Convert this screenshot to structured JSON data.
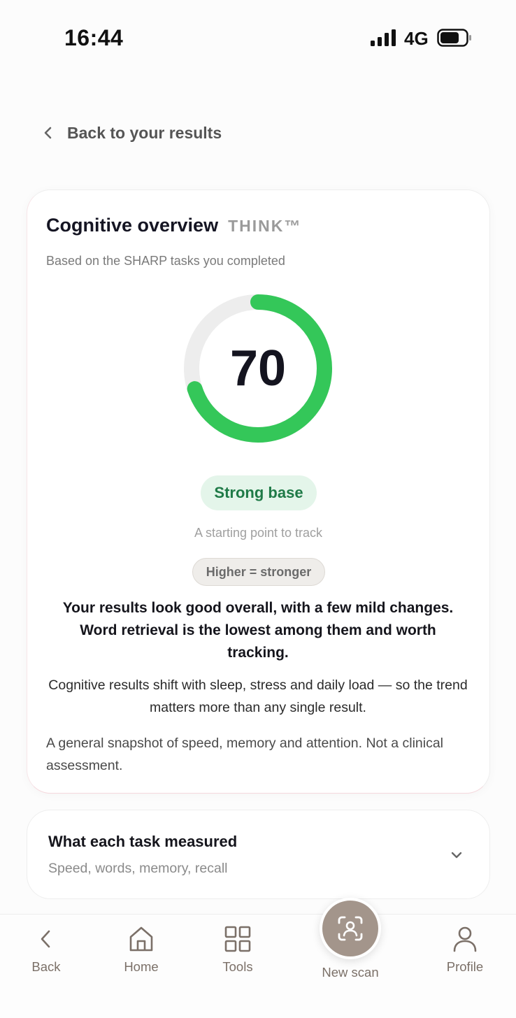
{
  "status_bar": {
    "time": "16:44",
    "network": "4G"
  },
  "back_link": {
    "label": "Back to your results"
  },
  "overview": {
    "title": "Cognitive overview",
    "brand": "THINK™",
    "subtitle": "Based on the SHARP tasks you completed",
    "score": "70",
    "score_fraction": 0.7,
    "ring_color": "#34c759",
    "ring_track_color": "#ededed",
    "status_label": "Strong base",
    "status_caption": "A starting point to track",
    "scale_hint": "Higher = stronger",
    "summary": "Your results look good overall, with a few mild changes. Word retrieval is the lowest among them and worth tracking.",
    "trend_note": "Cognitive results shift with sleep, stress and daily load — so the trend matters more than any single result.",
    "disclaimer": "A general snapshot of speed, memory and attention. Not a clinical assessment."
  },
  "task_section": {
    "title": "What each task measured",
    "subtitle": "Speed, words, memory, recall",
    "icon": "chevron-down-icon"
  },
  "bottom_nav": {
    "back": "Back",
    "home": "Home",
    "tools": "Tools",
    "new_scan": "New scan",
    "profile": "Profile"
  },
  "colors": {
    "accent_green": "#34c759",
    "nav_brown": "#a3958b"
  }
}
